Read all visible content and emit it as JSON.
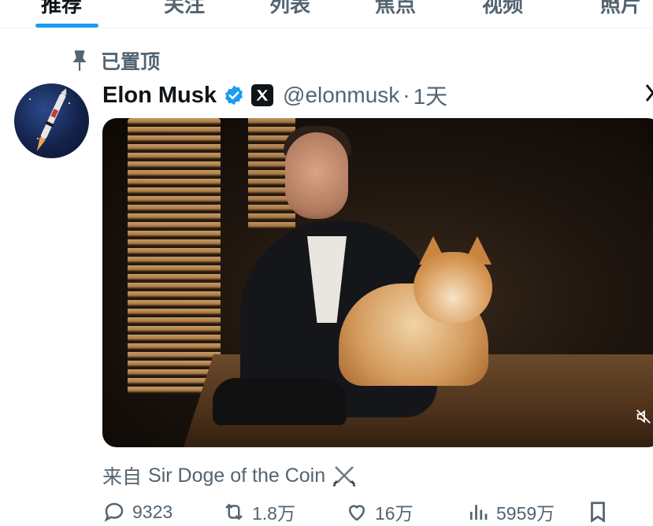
{
  "tabs": [
    {
      "label": "推荐",
      "active": true
    },
    {
      "label": "关注",
      "active": false
    },
    {
      "label": "列表",
      "active": false
    },
    {
      "label": "焦点",
      "active": false
    },
    {
      "label": "视频",
      "active": false
    },
    {
      "label": "照片",
      "active": false
    }
  ],
  "pinned": {
    "label": "已置顶",
    "icon": "pin-icon"
  },
  "tweet": {
    "author_name": "Elon Musk",
    "handle": "@elonmusk",
    "separator": "·",
    "time": "1天",
    "verified_icon": "verified-badge-icon",
    "affiliate_icon": "x-logo-icon",
    "media_icon": "muted-volume-icon",
    "source_prefix": "来自",
    "source_name": "Sir Doge of the Coin",
    "source_icon": "crossed-swords-icon"
  },
  "actions": {
    "reply_count": "9323",
    "retweet_count": "1.8万",
    "like_count": "16万",
    "view_count": "5959万"
  },
  "colors": {
    "accent": "#1d9bf0",
    "text_primary": "#0f1419",
    "text_secondary": "#536471"
  }
}
